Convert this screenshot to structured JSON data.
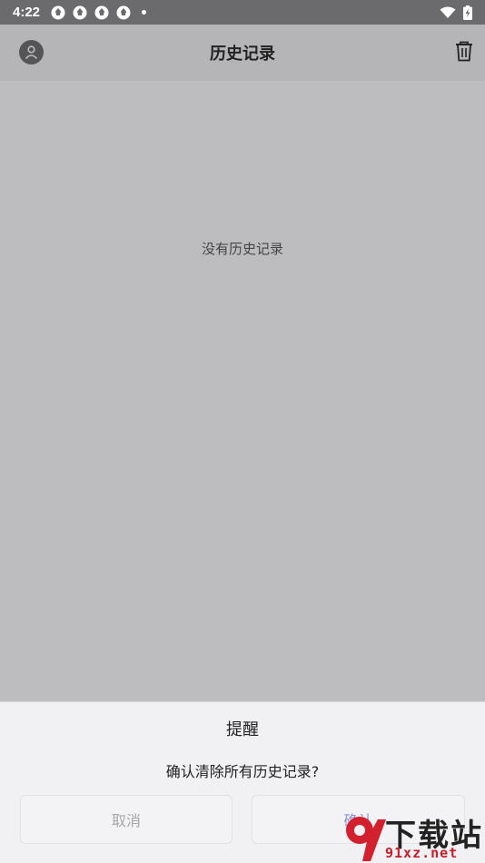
{
  "status_bar": {
    "time": "4:22",
    "notification_icons": [
      "aperture-icon",
      "aperture-icon",
      "aperture-icon",
      "aperture-icon"
    ],
    "right_icons": [
      "wifi-icon",
      "battery-charging-icon"
    ]
  },
  "app_bar": {
    "title": "历史记录",
    "left_icon": "user-avatar-icon",
    "right_icon": "trash-icon"
  },
  "content": {
    "empty_message": "没有历史记录"
  },
  "dialog": {
    "title": "提醒",
    "message": "确认清除所有历史记录?",
    "cancel_label": "取消",
    "confirm_label": "确认"
  },
  "watermark": {
    "brand_text": "下载站",
    "domain_text": "91xz.net"
  },
  "colors": {
    "status_bar": "#6b6b6d",
    "app_bar": "#b5b5b7",
    "content_bg": "#bdbdbf",
    "dialog_bg": "#f1f1f4",
    "confirm_text": "#8d8dd6",
    "watermark_red": "#c81e2a"
  }
}
